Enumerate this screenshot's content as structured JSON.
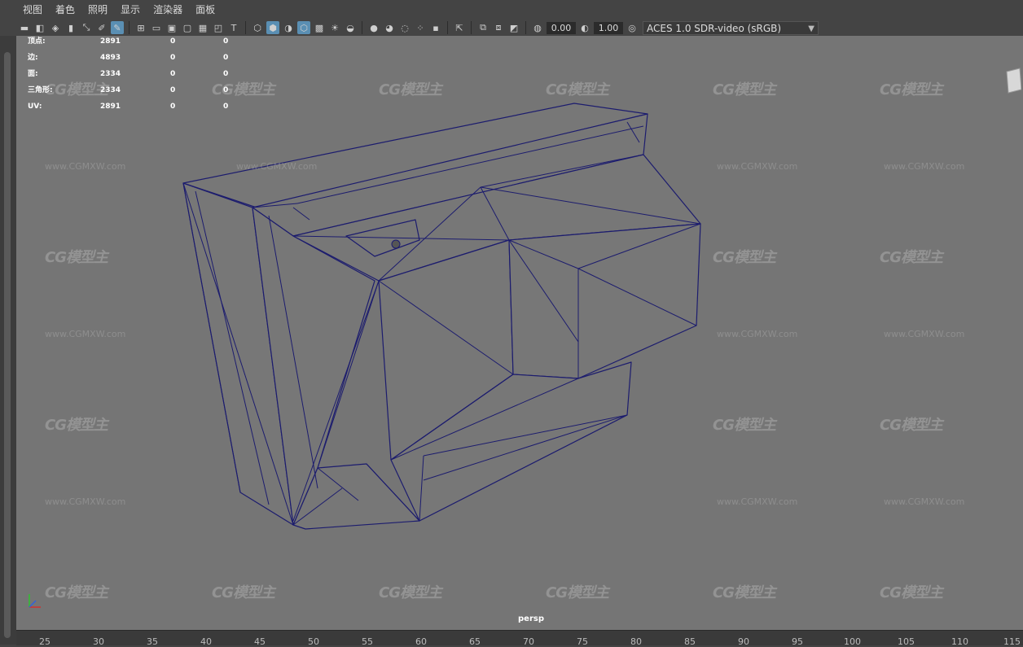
{
  "menu": [
    "视图",
    "着色",
    "照明",
    "显示",
    "渲染器",
    "面板"
  ],
  "toolbar": {
    "exposure": "0.00",
    "gamma": "1.00",
    "color_space": "ACES 1.0 SDR-video (sRGB)"
  },
  "hud": {
    "rows": [
      {
        "label": "顶点:",
        "value": "2891",
        "a": "0",
        "b": "0"
      },
      {
        "label": "边:",
        "value": "4893",
        "a": "0",
        "b": "0"
      },
      {
        "label": "面:",
        "value": "2334",
        "a": "0",
        "b": "0"
      },
      {
        "label": "三角形:",
        "value": "2334",
        "a": "0",
        "b": "0"
      },
      {
        "label": "UV:",
        "value": "2891",
        "a": "0",
        "b": "0"
      }
    ]
  },
  "camera_label": "persp",
  "watermark": {
    "logo": "CG模型主",
    "url": "www.CGMXW.com"
  },
  "ruler_ticks": [
    "25",
    "30",
    "35",
    "40",
    "45",
    "50",
    "55",
    "60",
    "65",
    "70",
    "75",
    "80",
    "85",
    "90",
    "95",
    "100",
    "105",
    "110",
    "115"
  ],
  "colors": {
    "viewport": "#757575",
    "wire": "#1c1c6e",
    "accent": "#5a8fb3"
  }
}
